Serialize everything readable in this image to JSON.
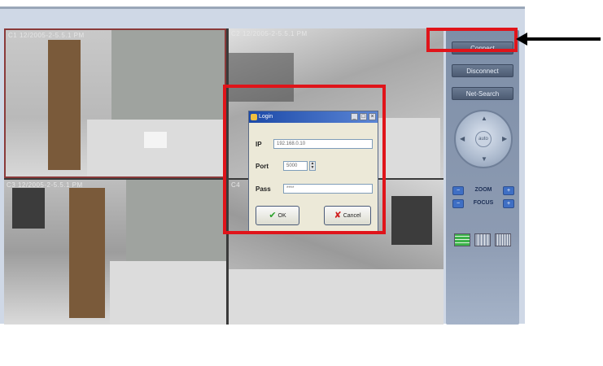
{
  "cameras": [
    {
      "label": "C1  12/2005-2-5.5.1 PM"
    },
    {
      "label": "C2  12/2005-2-5.5.1 PM"
    },
    {
      "label": "C3  12/2005-2-5.5.1 PM"
    },
    {
      "label": "C4"
    }
  ],
  "panel": {
    "connect": "Connect",
    "disconnect": "Disconnect",
    "net_search": "Net-Search",
    "ptz_center": "auto",
    "zoom": "ZOOM",
    "focus": "FOCUS"
  },
  "dialog": {
    "title": "Login",
    "ip_label": "IP",
    "ip_value": "192.168.0.10",
    "port_label": "Port",
    "port_value": "5000",
    "pass_label": "Pass",
    "pass_value": "****",
    "ok": "OK",
    "cancel": "Cancel"
  },
  "colors": {
    "highlight": "#e0141a",
    "ok_check": "#2aa12a",
    "cancel_x": "#d02020"
  }
}
